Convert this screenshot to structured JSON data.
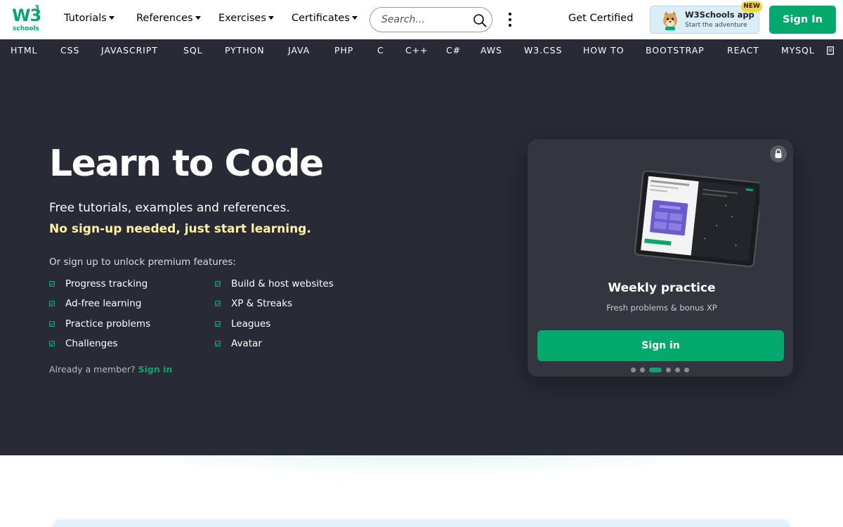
{
  "logo": {
    "main": "W3",
    "superscript": "3",
    "sub": "schools"
  },
  "nav": {
    "tutorials": "Tutorials",
    "references": "References",
    "exercises": "Exercises",
    "certificates": "Certificates",
    "search_placeholder": "Search...",
    "get_certified": "Get Certified",
    "app_title": "W3Schools app",
    "app_subtitle": "Start the adventure",
    "new_badge": "NEW",
    "sign_in": "Sign In"
  },
  "subnav": [
    "HTML",
    "CSS",
    "JAVASCRIPT",
    "SQL",
    "PYTHON",
    "JAVA",
    "PHP",
    "C",
    "C++",
    "C#",
    "AWS",
    "W3.CSS",
    "HOW TO",
    "BOOTSTRAP",
    "REACT",
    "MYSQL"
  ],
  "hero": {
    "title": "Learn to Code",
    "subtitle1": "Free tutorials, examples and references.",
    "subtitle2": "No sign-up needed, just start learning.",
    "or_signup": "Or sign up to unlock premium features:",
    "features_left": [
      "Progress tracking",
      "Ad-free learning",
      "Practice problems",
      "Challenges"
    ],
    "features_right": [
      "Build & host websites",
      "XP & Streaks",
      "Leagues",
      "Avatar"
    ],
    "already_member": "Already a member?",
    "sign_in_link": "Sign in"
  },
  "card": {
    "title": "Weekly practice",
    "description": "Fresh problems & bonus XP",
    "button": "Sign in",
    "dots_total": 6,
    "active_dot": 3
  },
  "colors": {
    "accent": "#04AA6D",
    "dark_bg": "#282A35",
    "highlight": "#FFF4A3"
  }
}
